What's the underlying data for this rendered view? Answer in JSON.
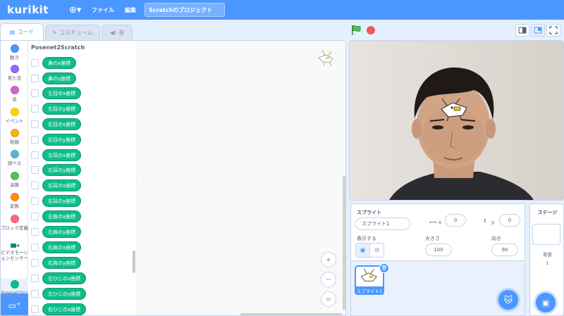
{
  "menubar": {
    "logo": "kurikit",
    "file_label": "ファイル",
    "edit_label": "編集",
    "project_title": "Scratchのプロジェクト"
  },
  "tabs": [
    {
      "label": "コード",
      "icon": "code-icon",
      "active": true
    },
    {
      "label": "コスチューム",
      "icon": "brush-icon",
      "active": false
    },
    {
      "label": "音",
      "icon": "speaker-icon",
      "active": false
    }
  ],
  "categories": [
    {
      "label": "動き",
      "color": "#4c97ff"
    },
    {
      "label": "見た目",
      "color": "#9966ff"
    },
    {
      "label": "音",
      "color": "#cf63cf"
    },
    {
      "label": "イベント",
      "color": "#ffd500"
    },
    {
      "label": "制御",
      "color": "#ffab19"
    },
    {
      "label": "調べる",
      "color": "#5cb1d6"
    },
    {
      "label": "演算",
      "color": "#59c059"
    },
    {
      "label": "変数",
      "color": "#ff8c1a"
    },
    {
      "label": "ブロック定義",
      "color": "#ff6680"
    },
    {
      "label": "ビデオモーションセンサー",
      "color": ""
    },
    {
      "label": "Posenet2Scr",
      "color": "#0fbd8c"
    }
  ],
  "palette": {
    "title": "Posenet2Scratch",
    "blocks": [
      "鼻のx座標",
      "鼻のy座標",
      "左目のx座標",
      "左目のy座標",
      "右目のx座標",
      "右目のy座標",
      "左耳のx座標",
      "左耳のy座標",
      "右耳のx座標",
      "右耳のy座標",
      "左肩のx座標",
      "左肩のy座標",
      "右肩のx座標",
      "右肩のy座標",
      "左ひじのx座標",
      "左ひじのy座標",
      "右ひじのx座標"
    ]
  },
  "zoom": {
    "in": "+",
    "out": "−",
    "reset": "="
  },
  "sprite_info": {
    "sprite_label": "スプライト",
    "sprite_name": "スプライト1",
    "x_label": "x",
    "x_value": "0",
    "y_label": "y",
    "y_value": "0",
    "show_label": "表示する",
    "size_label": "大きさ",
    "size_value": "100",
    "direction_label": "向き",
    "direction_value": "90"
  },
  "sprite_list": {
    "items": [
      {
        "name": "スプライト1",
        "selected": true
      }
    ]
  },
  "stage_panel": {
    "title": "ステージ",
    "backdrop_label": "背景",
    "backdrop_count": "1"
  },
  "colors": {
    "accent": "#4c97ff",
    "extension": "#0fbd8c",
    "stop": "#ec5959",
    "flag": "#4cbf56"
  }
}
